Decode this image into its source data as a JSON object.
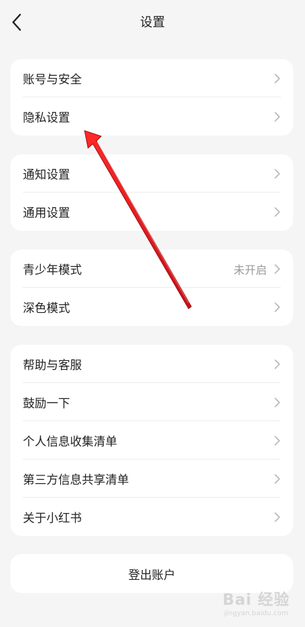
{
  "header": {
    "title": "设置"
  },
  "cards": [
    {
      "rows": [
        "账号与安全",
        "隐私设置"
      ]
    },
    {
      "rows": [
        "通知设置",
        "通用设置"
      ]
    },
    {
      "rows": [
        "青少年模式",
        "深色模式"
      ],
      "youth_status": "未开启"
    },
    {
      "rows": [
        "帮助与客服",
        "鼓励一下",
        "个人信息收集清单",
        "第三方信息共享清单",
        "关于小红书"
      ]
    }
  ],
  "logout_label": "登出账户",
  "watermark": {
    "main": "Bai 经验",
    "sub": "jingyan.baidu.com"
  },
  "colors": {
    "background": "#f5f5f5",
    "card": "#ffffff",
    "annotation_arrow": "#e8141a"
  },
  "icons": {
    "back": "chevron-left-icon",
    "row": "chevron-right-icon"
  }
}
